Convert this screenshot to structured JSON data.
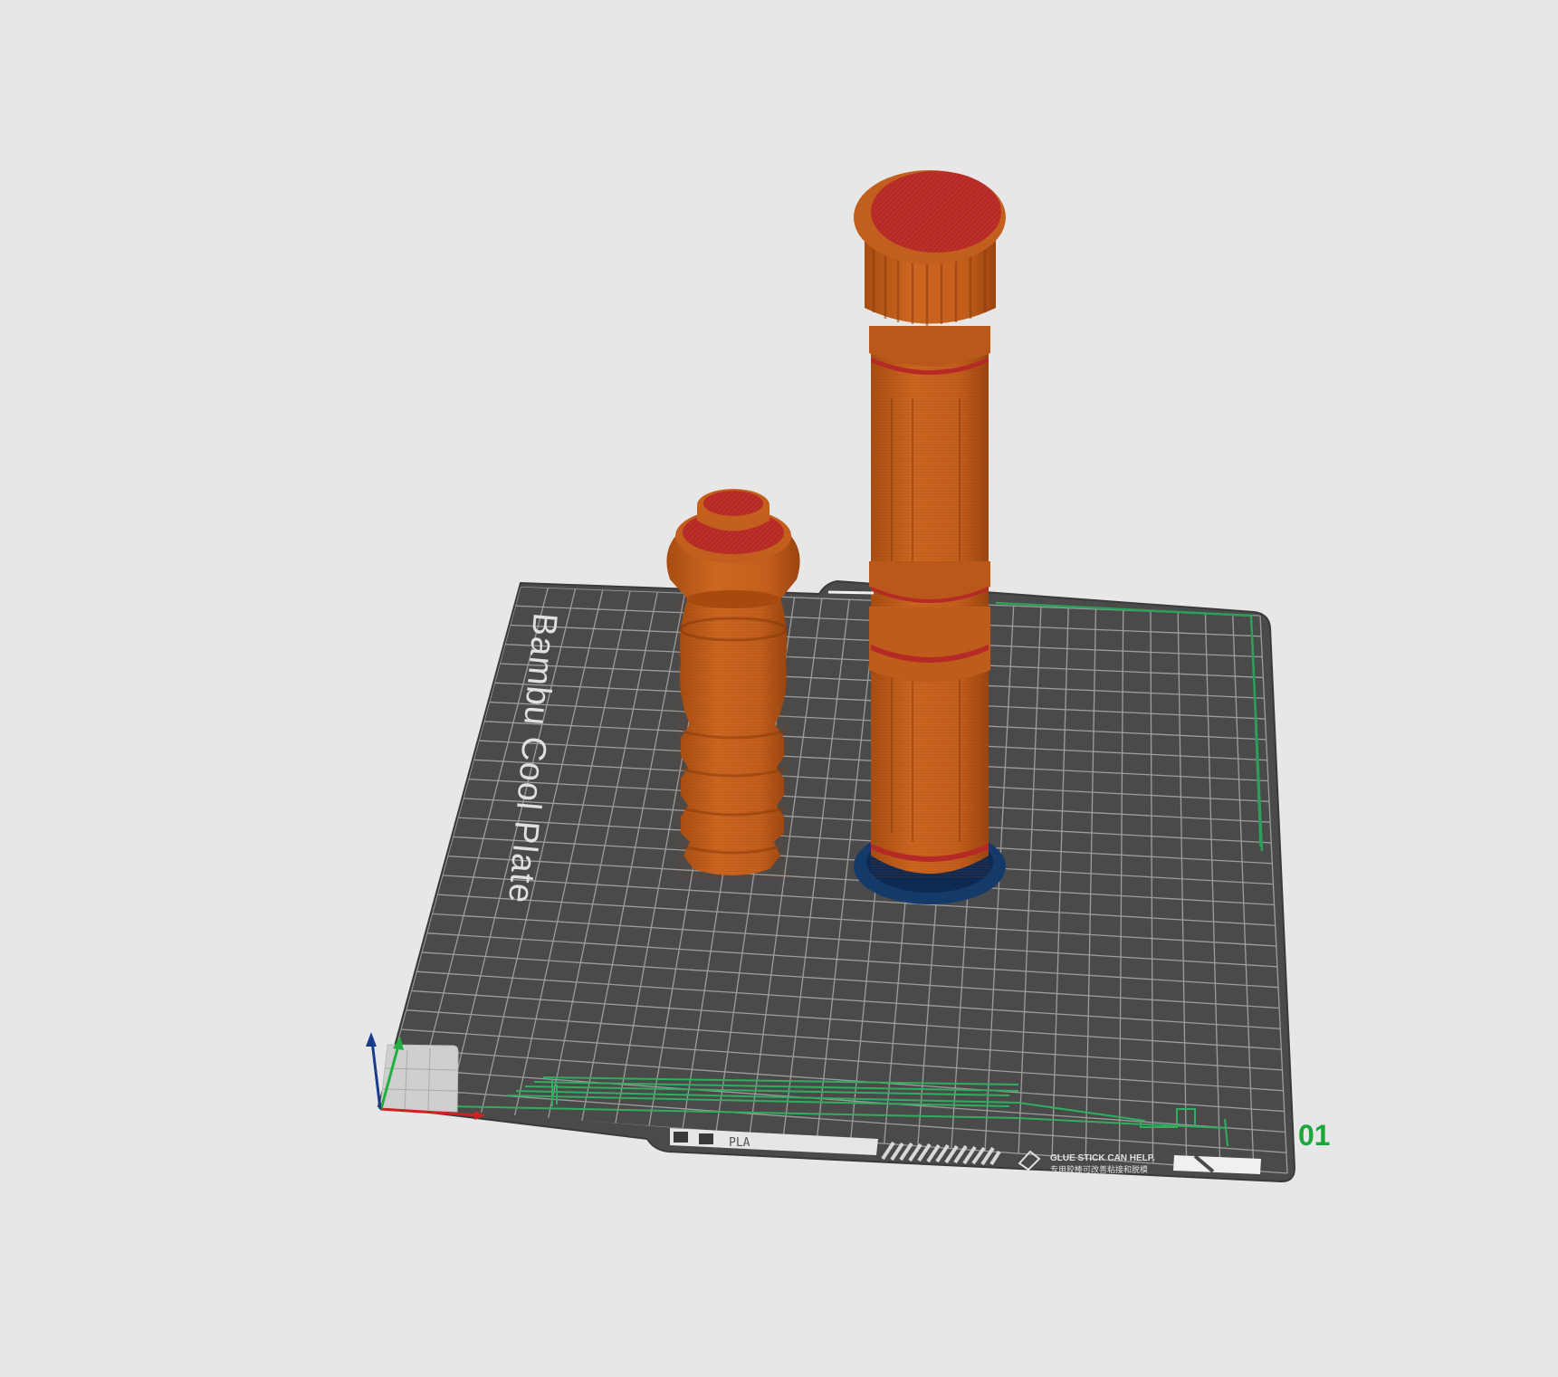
{
  "viewport": {
    "background": "#e7e7e7"
  },
  "plate": {
    "name": "Bambu Cool Plate",
    "filament_label": "PLA",
    "sticker_line_1": "GLUE STICK CAN HELP.",
    "sticker_line_2": "专用胶棒可改善粘接和脱模",
    "plate_number": "01",
    "colors": {
      "surface": "#4b4b4b",
      "grid": "#9a9a9a",
      "boundary": "#2aa05a",
      "plate_number": "#19a83a"
    }
  },
  "models": [
    {
      "name": "short-ribbed-part",
      "color": "#c4601c",
      "top_color": "#b52a26"
    },
    {
      "name": "tall-cylinder-part",
      "color": "#c4601c",
      "top_color": "#b52a26",
      "brim_color": "#143a6a"
    }
  ],
  "axes": {
    "x_color": "#d02020",
    "y_color": "#20b040",
    "z_color": "#1a3a8a"
  }
}
